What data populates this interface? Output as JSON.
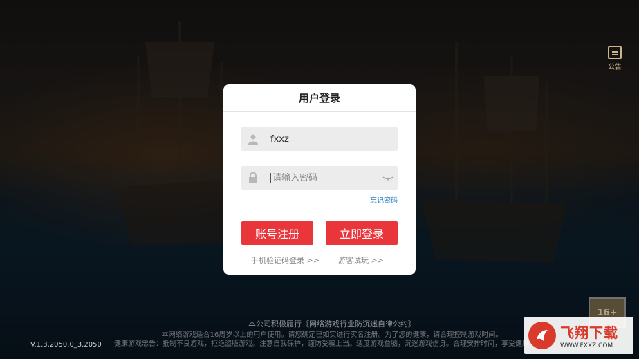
{
  "notice": {
    "label": "公告"
  },
  "dialog": {
    "title": "用户登录",
    "username_value": "fxxz",
    "password_placeholder": "请输入密码",
    "forgot_label": "忘记密码",
    "register_label": "账号注册",
    "login_label": "立即登录",
    "sms_login_label": "手机验证码登录 >>",
    "guest_label": "游客试玩 >>"
  },
  "footer": {
    "title": "本公司积极履行《网络游戏行业防沉迷自律公约》",
    "line1": "本网络游戏适合16周岁以上的用户使用。请您确定已如实进行实名注册。为了您的健康，请合理控制游戏时间。",
    "line2": "健康游戏忠告：抵制不良游戏，拒绝盗版游戏。注意自我保护，谨防受骗上当。适度游戏益脑，沉迷游戏伤身。合理安排时间，享受健康生活。",
    "version": "V.1.3.2050.0_3.2050"
  },
  "age_rating": "16+",
  "watermark": {
    "brand": "飞翔下载",
    "url": "WWW.FXXZ.COM"
  },
  "colors": {
    "primary_button": "#e8363a",
    "link": "#2e86c1"
  }
}
